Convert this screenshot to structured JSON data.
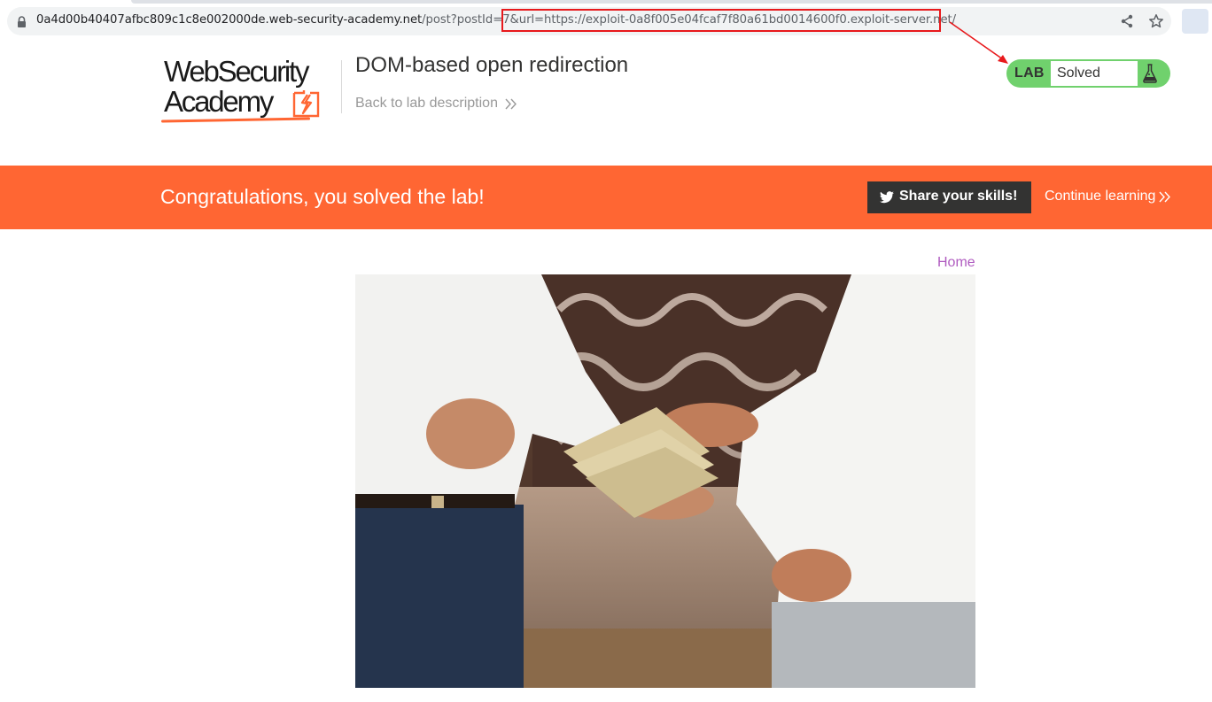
{
  "browser": {
    "url_host": "0a4d00b40407afbc809c1c8e002000de.web-security-academy.net",
    "url_path": "/post?postId=7",
    "url_query": "&url=https://exploit-0a8f005e04fcaf7f80a61bd0014600f0.exploit-server.net/"
  },
  "header": {
    "logo_line1": "WebSecurity",
    "logo_line2": "Academy",
    "lab_title": "DOM-based open redirection",
    "back_link": "Back to lab description"
  },
  "lab_status": {
    "badge": "LAB",
    "status": "Solved"
  },
  "banner": {
    "message": "Congratulations, you solved the lab!",
    "share_label": "Share your skills!",
    "continue_label": "Continue learning"
  },
  "post": {
    "home_link": "Home"
  },
  "colors": {
    "brand_orange": "#ff6633",
    "solved_green": "#70d16d",
    "dark": "#333332",
    "link_purple": "#b05cc0",
    "annotation_red": "#e8191c"
  },
  "icons": [
    "lock-icon",
    "share-icon",
    "star-icon",
    "double-chevron-icon",
    "flask-icon",
    "twitter-icon"
  ]
}
